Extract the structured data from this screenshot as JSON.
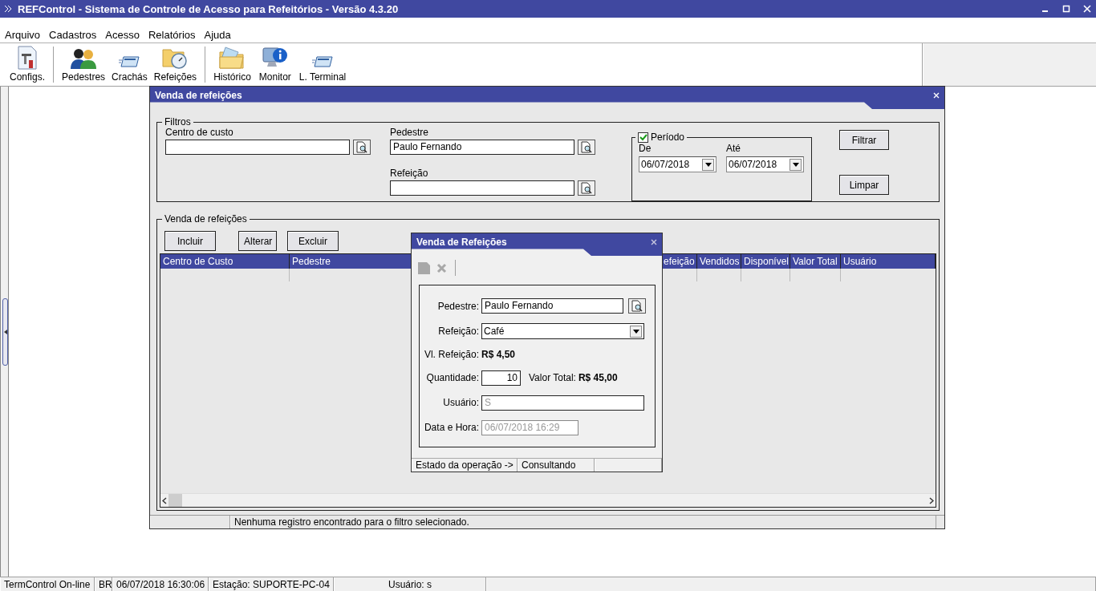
{
  "window": {
    "title": "REFControl - Sistema de Controle de Acesso para Refeitórios - Versão 4.3.20"
  },
  "menu": [
    "Arquivo",
    "Cadastros",
    "Acesso",
    "Relatórios",
    "Ajuda"
  ],
  "toolbar": [
    {
      "items": [
        "Configs."
      ]
    },
    {
      "items": [
        "Pedestres",
        "Crachás",
        "Refeições"
      ]
    },
    {
      "items": [
        "Histórico",
        "Monitor",
        "L. Terminal"
      ]
    }
  ],
  "child_window": {
    "title": "Venda de refeições",
    "filters": {
      "legend": "Filtros",
      "fields": [
        {
          "label": "Centro de custo"
        },
        {
          "label": "Pedestre",
          "value": "Paulo Fernando"
        },
        {
          "label": "Refeição"
        }
      ],
      "period": {
        "legend": "Período",
        "checked": true,
        "from": {
          "label": "De",
          "value": "06/07/2018"
        },
        "to": {
          "label": "Até",
          "value": "06/07/2018"
        }
      },
      "buttons": [
        "Filtrar",
        "Limpar"
      ]
    },
    "sales": {
      "legend": "Venda de refeições",
      "buttons": [
        "Incluir",
        "Alterar",
        "Excluir"
      ],
      "columns": [
        "Centro de Custo",
        "Pedestre",
        "efeição",
        "Vendidos",
        "Disponível",
        "Valor Total",
        "Usuário"
      ]
    },
    "status": "Nenhuma registro encontrado para o filtro selecionado."
  },
  "dialog": {
    "title": "Venda de Refeições",
    "toolbar": [
      {
        "disabled": true
      },
      {
        "disabled": true
      }
    ],
    "pedestre": {
      "label": "Pedestre:",
      "value": "Paulo Fernando"
    },
    "refeicao": {
      "label": "Refeição:",
      "value": "Café"
    },
    "valor_refeicao": {
      "label": "Vl. Refeição:",
      "value": "R$ 4,50"
    },
    "quantidade": {
      "label": "Quantidade:",
      "value": "10"
    },
    "valor_total": {
      "label": "Valor Total:",
      "value": "R$ 45,00"
    },
    "usuario": {
      "label": "Usuário:",
      "value": "S",
      "disabled": true
    },
    "data_hora": {
      "label": "Data e Hora:",
      "value": "06/07/2018 16:29",
      "disabled": true
    },
    "status": [
      "Estado da operação ->",
      "Consultando"
    ]
  },
  "status_bar": [
    "TermControl On-line",
    "BR",
    "06/07/2018 16:30:06",
    "Estação: SUPORTE-PC-04",
    "Usuário: s"
  ]
}
